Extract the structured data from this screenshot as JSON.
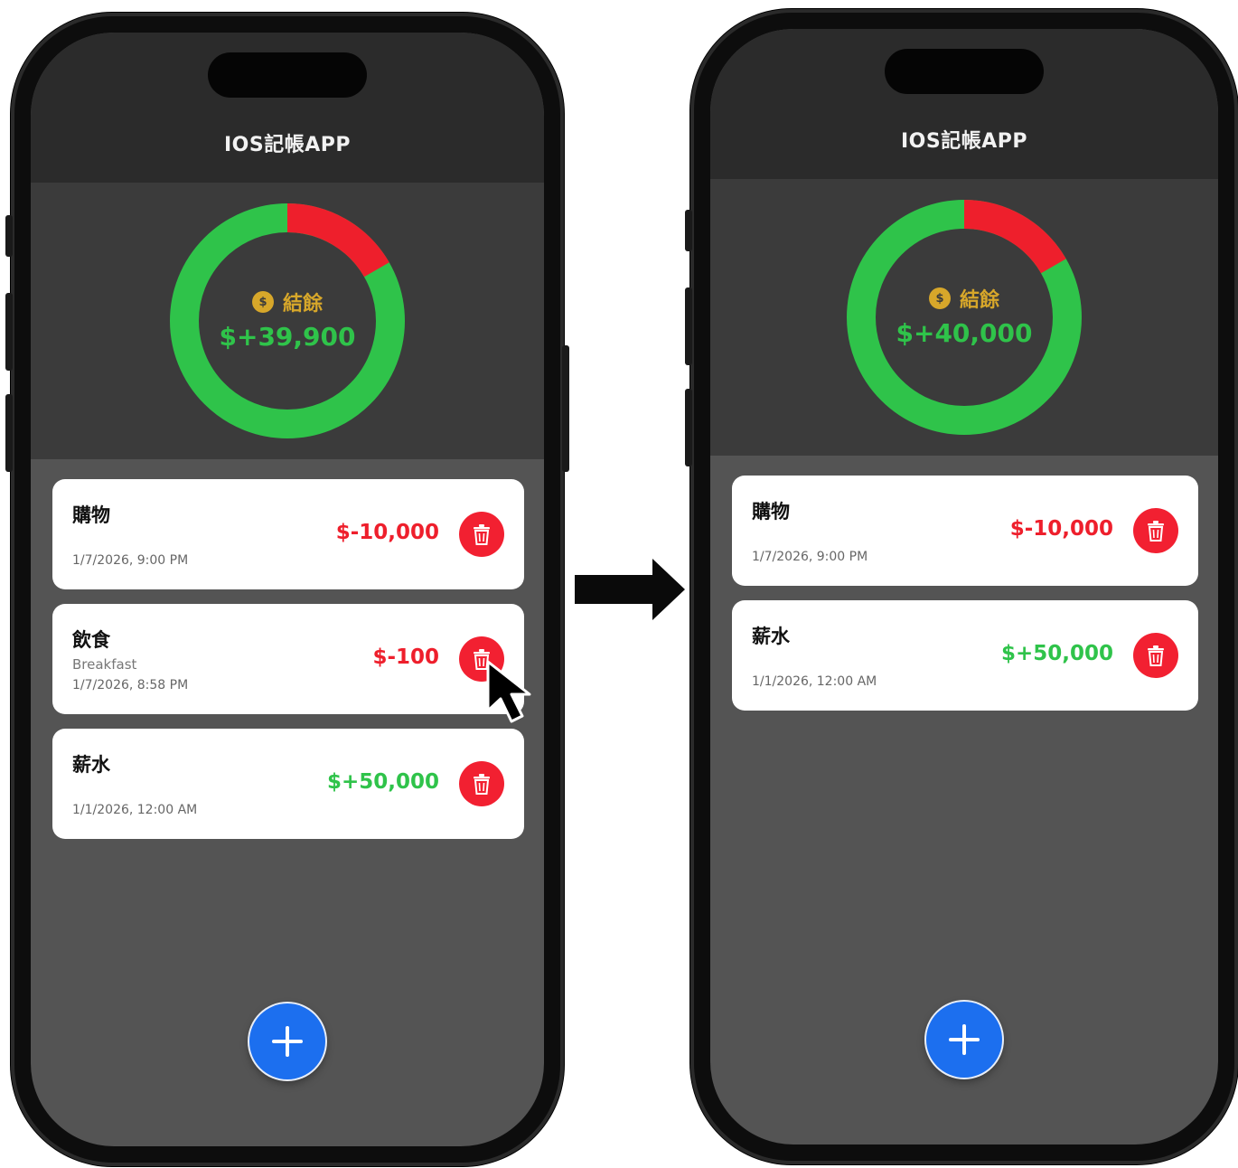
{
  "colors": {
    "expense": "#ee1f2c",
    "income": "#2fc34a",
    "balance_label": "#d7a72a",
    "fab": "#1c6fef",
    "delete": "#f22031"
  },
  "before": {
    "app_title": "IOS記帳APP",
    "balance_label": "結餘",
    "balance_value": "$+39,900",
    "donut": {
      "income_share": 0.833,
      "expense_share": 0.167
    },
    "transactions": [
      {
        "title": "購物",
        "note": "",
        "date": "1/7/2026, 9:00 PM",
        "amount": "$-10,000",
        "type": "expense"
      },
      {
        "title": "飲食",
        "note": "Breakfast",
        "date": "1/7/2026, 8:58 PM",
        "amount": "$-100",
        "type": "expense"
      },
      {
        "title": "薪水",
        "note": "",
        "date": "1/1/2026, 12:00 AM",
        "amount": "$+50,000",
        "type": "income"
      }
    ]
  },
  "after": {
    "app_title": "IOS記帳APP",
    "balance_label": "結餘",
    "balance_value": "$+40,000",
    "donut": {
      "income_share": 0.833,
      "expense_share": 0.167
    },
    "transactions": [
      {
        "title": "購物",
        "note": "",
        "date": "1/7/2026, 9:00 PM",
        "amount": "$-10,000",
        "type": "expense"
      },
      {
        "title": "薪水",
        "note": "",
        "date": "1/1/2026, 12:00 AM",
        "amount": "$+50,000",
        "type": "income"
      }
    ]
  },
  "icons": {
    "coin": "dollar-coin-icon",
    "delete": "trash-icon",
    "add": "plus-icon",
    "transition": "right-arrow-icon",
    "pointer": "mouse-cursor-icon"
  },
  "coin_symbol": "$"
}
